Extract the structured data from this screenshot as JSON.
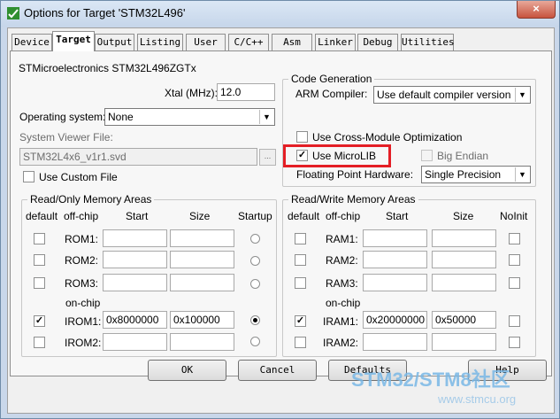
{
  "window": {
    "title": "Options for Target 'STM32L496'",
    "close_glyph": "×"
  },
  "tabs": [
    "Device",
    "Target",
    "Output",
    "Listing",
    "User",
    "C/C++",
    "Asm",
    "Linker",
    "Debug",
    "Utilities"
  ],
  "device": "STMicroelectronics STM32L496ZGTx",
  "xtal": {
    "label": "Xtal (MHz):",
    "value": "12.0"
  },
  "os": {
    "label": "Operating system:",
    "value": "None"
  },
  "svd": {
    "label": "System Viewer File:",
    "value": "STM32L4x6_v1r1.svd",
    "browse": "..."
  },
  "custom_file": {
    "label": "Use Custom File",
    "checked": false
  },
  "codegen": {
    "title": "Code Generation",
    "compiler_label": "ARM Compiler:",
    "compiler_value": "Use default compiler version",
    "cross_module": "Use Cross-Module Optimization",
    "microlib": "Use MicroLIB",
    "big_endian": "Big Endian",
    "fpu_label": "Floating Point Hardware:",
    "fpu_value": "Single Precision"
  },
  "rom_area": {
    "title": "Read/Only Memory Areas",
    "headers": {
      "default": "default",
      "offchip": "off-chip",
      "start": "Start",
      "size": "Size",
      "startup": "Startup"
    },
    "onchip": "on-chip",
    "rows": [
      {
        "name": "ROM1:",
        "start": "",
        "size": "",
        "checked": false,
        "selected": false
      },
      {
        "name": "ROM2:",
        "start": "",
        "size": "",
        "checked": false,
        "selected": false
      },
      {
        "name": "ROM3:",
        "start": "",
        "size": "",
        "checked": false,
        "selected": false
      },
      {
        "name": "IROM1:",
        "start": "0x8000000",
        "size": "0x100000",
        "checked": true,
        "selected": true
      },
      {
        "name": "IROM2:",
        "start": "",
        "size": "",
        "checked": false,
        "selected": false
      }
    ]
  },
  "ram_area": {
    "title": "Read/Write Memory Areas",
    "headers": {
      "default": "default",
      "offchip": "off-chip",
      "start": "Start",
      "size": "Size",
      "noinit": "NoInit"
    },
    "onchip": "on-chip",
    "rows": [
      {
        "name": "RAM1:",
        "start": "",
        "size": "",
        "checked": false
      },
      {
        "name": "RAM2:",
        "start": "",
        "size": "",
        "checked": false
      },
      {
        "name": "RAM3:",
        "start": "",
        "size": "",
        "checked": false
      },
      {
        "name": "IRAM1:",
        "start": "0x20000000",
        "size": "0x50000",
        "checked": true
      },
      {
        "name": "IRAM2:",
        "start": "",
        "size": "",
        "checked": false
      }
    ]
  },
  "buttons": {
    "ok": "OK",
    "cancel": "Cancel",
    "defaults": "Defaults",
    "help": "Help"
  },
  "watermark": {
    "line1": "STM32/STM8社区",
    "line2": "www.stmcu.org"
  },
  "colors": {
    "highlight": "#e41e25",
    "titlebar": "#c9d7ea",
    "close": "#c7533e"
  }
}
